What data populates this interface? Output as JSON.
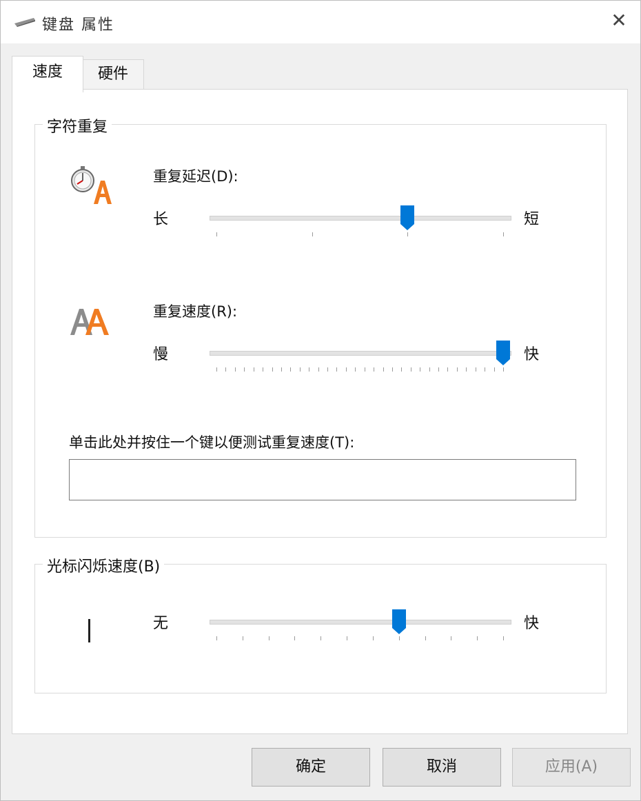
{
  "window": {
    "title": "键盘 属性",
    "close_symbol": "✕"
  },
  "tabs": [
    {
      "label": "速度",
      "active": true
    },
    {
      "label": "硬件",
      "active": false
    }
  ],
  "char_repeat": {
    "legend": "字符重复",
    "delay": {
      "label": "重复延迟(D):",
      "min_label": "长",
      "max_label": "短",
      "value": 2,
      "max": 3,
      "icon": "stopwatch-a-icon"
    },
    "rate": {
      "label": "重复速度(R):",
      "min_label": "慢",
      "max_label": "快",
      "value": 31,
      "max": 31,
      "icon": "double-a-icon"
    },
    "test": {
      "label": "单击此处并按住一个键以便测试重复速度(T):",
      "value": ""
    }
  },
  "cursor_blink": {
    "legend": "光标闪烁速度(B)",
    "min_label": "无",
    "max_label": "快",
    "value": 7,
    "max": 11,
    "icon": "text-cursor-icon"
  },
  "buttons": {
    "ok": "确定",
    "cancel": "取消",
    "apply": "应用(A)"
  },
  "colors": {
    "accent": "#0078d7",
    "icon_orange": "#f07c22"
  }
}
